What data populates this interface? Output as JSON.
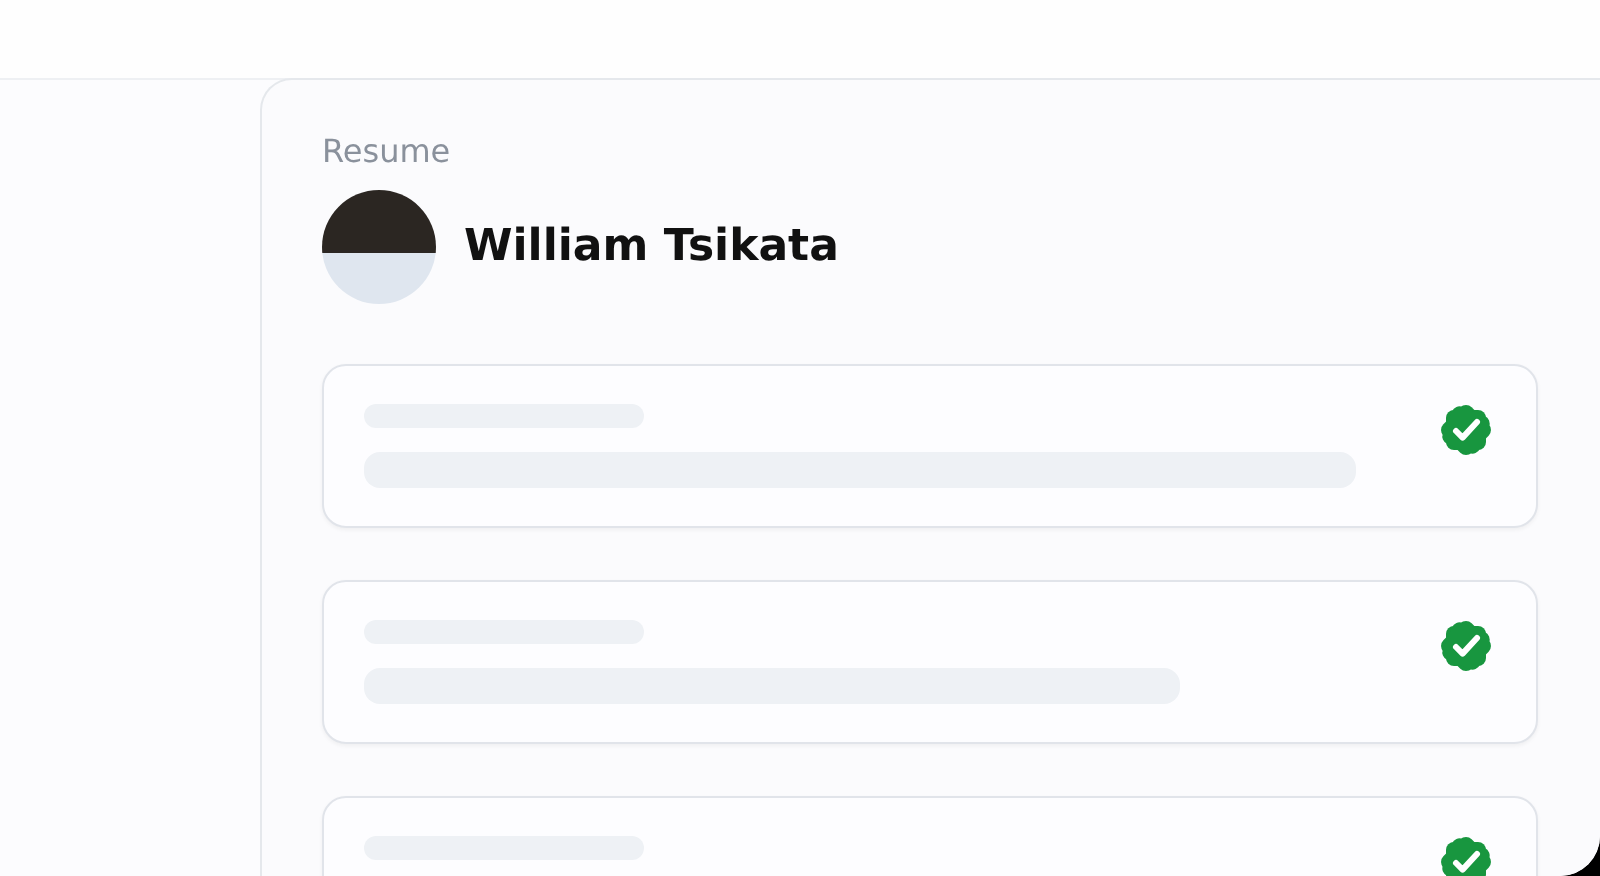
{
  "card": {
    "label": "Resume",
    "name": "William Tsikata"
  },
  "items": [
    {
      "verified": true
    },
    {
      "verified": true
    },
    {
      "verified": true
    }
  ]
}
